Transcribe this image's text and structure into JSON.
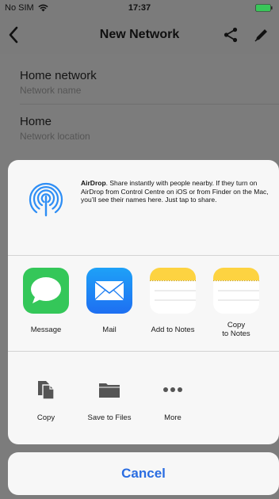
{
  "status_bar": {
    "carrier": "No SIM",
    "time": "17:37",
    "wifi_icon": "wifi-icon",
    "battery_icon": "battery-icon",
    "battery_color": "#39c759"
  },
  "nav": {
    "title": "New Network",
    "back_icon": "chevron-left-icon",
    "share_icon": "share-icon",
    "edit_icon": "pencil-icon"
  },
  "fields": [
    {
      "value": "Home network",
      "label": "Network name"
    },
    {
      "value": "Home",
      "label": "Network location"
    }
  ],
  "share_sheet": {
    "airdrop": {
      "icon": "airdrop-icon",
      "title": "AirDrop",
      "description": ". Share instantly with people nearby. If they turn on AirDrop from Control Centre on iOS or from Finder on the Mac, you’ll see their names here. Just tap to share."
    },
    "apps": [
      {
        "label": "Message",
        "icon": "messages-icon"
      },
      {
        "label": "Mail",
        "icon": "mail-icon"
      },
      {
        "label": "Add to Notes",
        "icon": "notes-icon"
      },
      {
        "label": "Copy\nto Notes",
        "icon": "notes-icon"
      }
    ],
    "actions": [
      {
        "label": "Copy",
        "icon": "copy-icon"
      },
      {
        "label": "Save to Files",
        "icon": "folder-icon"
      },
      {
        "label": "More",
        "icon": "more-icon"
      }
    ],
    "cancel_label": "Cancel"
  },
  "colors": {
    "accent": "#2a6de1",
    "dim_background": "#7b7b7b",
    "sheet_background": "#f7f7f7",
    "messages_green": "#34c759",
    "mail_blue": "#2e8ef5",
    "notes_yellow": "#fdd341"
  }
}
